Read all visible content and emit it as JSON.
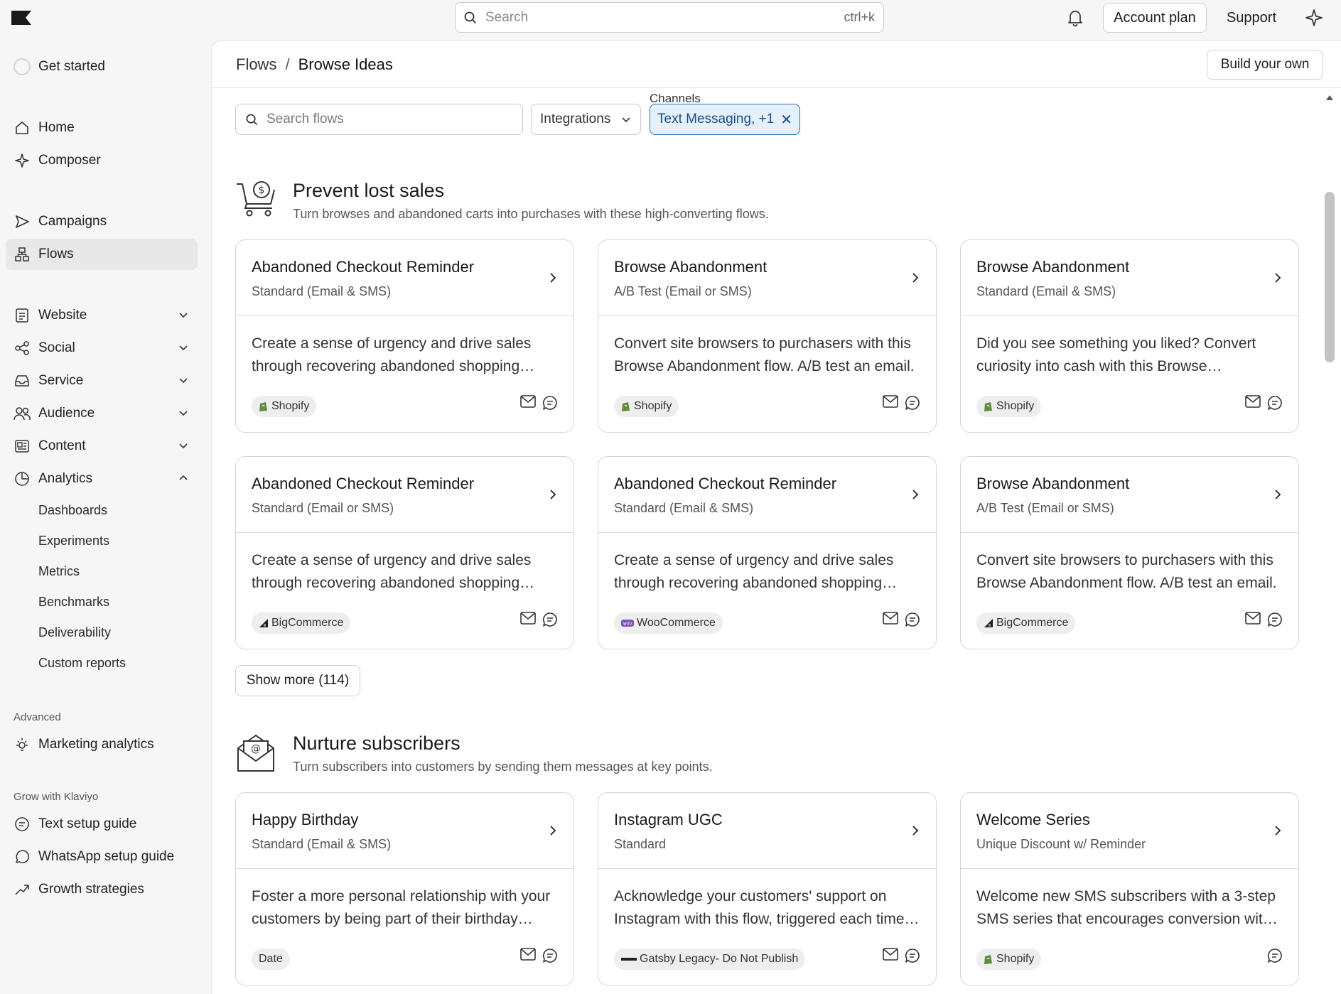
{
  "topbar": {
    "search_placeholder": "Search",
    "search_shortcut": "ctrl+k",
    "account_plan": "Account plan",
    "support": "Support"
  },
  "sidebar": {
    "get_started": "Get started",
    "home": "Home",
    "composer": "Composer",
    "campaigns": "Campaigns",
    "flows": "Flows",
    "website": "Website",
    "social": "Social",
    "service": "Service",
    "audience": "Audience",
    "content": "Content",
    "analytics": "Analytics",
    "analytics_sub": [
      "Dashboards",
      "Experiments",
      "Metrics",
      "Benchmarks",
      "Deliverability",
      "Custom reports"
    ],
    "advanced_label": "Advanced",
    "marketing_analytics": "Marketing analytics",
    "grow_label": "Grow with Klaviyo",
    "text_setup": "Text setup guide",
    "whatsapp_setup": "WhatsApp setup guide",
    "growth": "Growth strategies"
  },
  "header": {
    "crumb_root": "Flows",
    "crumb_sep": "/",
    "crumb_current": "Browse Ideas",
    "build_own": "Build your own"
  },
  "filters": {
    "search_placeholder": "Search flows",
    "integrations": "Integrations",
    "channels_label": "Channels",
    "channels_value": "Text Messaging, +1",
    "remove": "✕"
  },
  "sections": [
    {
      "title": "Prevent lost sales",
      "subtitle": "Turn browses and abandoned carts into purchases with these high-converting flows.",
      "cards": [
        {
          "title": "Abandoned Checkout Reminder",
          "subtitle": "Standard (Email & SMS)",
          "desc": "Create a sense of urgency and drive sales through recovering abandoned shopping carts.",
          "tag": "Shopify",
          "tag_icon": "shopify-icon",
          "channels": [
            "email",
            "sms"
          ]
        },
        {
          "title": "Browse Abandonment",
          "subtitle": "A/B Test (Email or SMS)",
          "desc": "Convert site browsers to purchasers with this Browse Abandonment flow. A/B test an email.",
          "tag": "Shopify",
          "tag_icon": "shopify-icon",
          "channels": [
            "email",
            "sms"
          ]
        },
        {
          "title": "Browse Abandonment",
          "subtitle": "Standard (Email & SMS)",
          "desc": "Did you see something you liked? Convert curiosity into cash with this Browse Abandonment flow.",
          "tag": "Shopify",
          "tag_icon": "shopify-icon",
          "channels": [
            "email",
            "sms"
          ]
        },
        {
          "title": "Abandoned Checkout Reminder",
          "subtitle": "Standard (Email or SMS)",
          "desc": "Create a sense of urgency and drive sales through recovering abandoned shopping carts.",
          "tag": "BigCommerce",
          "tag_icon": "bigcommerce-icon",
          "channels": [
            "email",
            "sms"
          ]
        },
        {
          "title": "Abandoned Checkout Reminder",
          "subtitle": "Standard (Email & SMS)",
          "desc": "Create a sense of urgency and drive sales through recovering abandoned shopping carts.",
          "tag": "WooCommerce",
          "tag_icon": "woocommerce-icon",
          "channels": [
            "email",
            "sms"
          ]
        },
        {
          "title": "Browse Abandonment",
          "subtitle": "A/B Test (Email or SMS)",
          "desc": "Convert site browsers to purchasers with this Browse Abandonment flow. A/B test an email.",
          "tag": "BigCommerce",
          "tag_icon": "bigcommerce-icon",
          "channels": [
            "email",
            "sms"
          ]
        }
      ]
    },
    {
      "title": "Nurture subscribers",
      "subtitle": "Turn subscribers into customers by sending them messages at key points.",
      "cards": [
        {
          "title": "Happy Birthday",
          "subtitle": "Standard (Email & SMS)",
          "desc": "Foster a more personal relationship with your customers by being part of their birthday celebrations.",
          "tag": "Date",
          "tag_icon": "",
          "channels": [
            "email",
            "sms"
          ]
        },
        {
          "title": "Instagram UGC",
          "subtitle": "Standard",
          "desc": "Acknowledge your customers' support on Instagram with this flow, triggered each time they tag you.",
          "tag": "Gatsby Legacy- Do Not Publish",
          "tag_icon": "gatsby-icon",
          "channels": [
            "email",
            "sms"
          ]
        },
        {
          "title": "Welcome Series",
          "subtitle": "Unique Discount w/ Reminder",
          "desc": "Welcome new SMS subscribers with a 3-step SMS series that encourages conversion with a discount.",
          "tag": "Shopify",
          "tag_icon": "shopify-icon",
          "channels": [
            "sms"
          ]
        }
      ]
    }
  ],
  "show_more": "Show more (114)"
}
